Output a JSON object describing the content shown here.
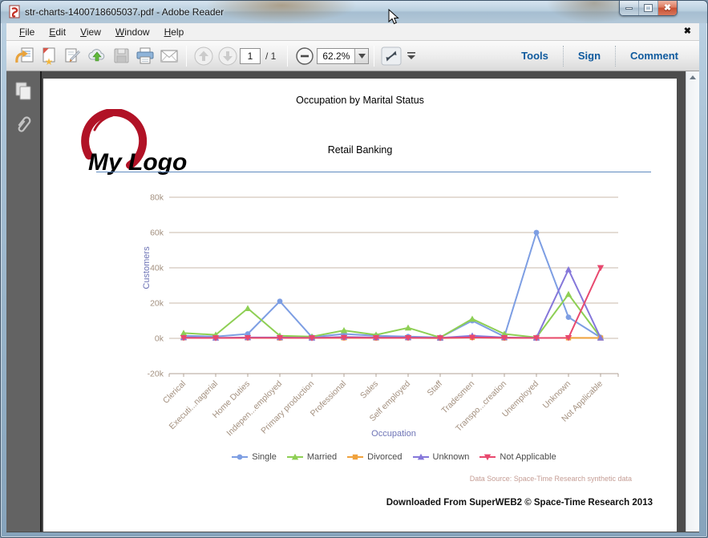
{
  "window": {
    "title": "str-charts-1400718605037.pdf - Adobe Reader"
  },
  "menubar": {
    "items": [
      {
        "label": "File"
      },
      {
        "label": "Edit"
      },
      {
        "label": "View"
      },
      {
        "label": "Window"
      },
      {
        "label": "Help"
      }
    ],
    "close_glyph": "✖"
  },
  "toolbar": {
    "icons": [
      "open-icon",
      "create-pdf-icon",
      "sign-doc-icon",
      "cloud-upload-icon",
      "save-icon",
      "print-icon",
      "email-icon",
      "prev-page-icon",
      "next-page-icon",
      "zoom-out-icon",
      "fit-window-icon",
      "toolbar-overflow-icon"
    ],
    "page_current": "1",
    "page_total": "/ 1",
    "zoom_value": "62.2%",
    "tools_label": "Tools",
    "sign_label": "Sign",
    "comment_label": "Comment"
  },
  "sidebar": {
    "icons": [
      "page-thumbnails-icon",
      "attachments-icon"
    ]
  },
  "document": {
    "title": "Occupation by Marital Status",
    "subtitle": "Retail Banking",
    "logo_text": "My Logo",
    "data_source": "Data Source: Space-Time Research synthetic data",
    "footer": "Downloaded From SuperWEB2 © Space-Time Research 2013"
  },
  "chart_data": {
    "type": "line",
    "title": "Occupation by Marital Status",
    "subtitle": "Retail Banking",
    "xlabel": "Occupation",
    "ylabel": "Customers",
    "ylim": [
      -20000,
      80000
    ],
    "ytick_labels": [
      "80k",
      "60k",
      "40k",
      "20k",
      "0k",
      "-20k"
    ],
    "ytick_values": [
      80000,
      60000,
      40000,
      20000,
      0,
      -20000
    ],
    "grid": "horizontal",
    "legend_position": "bottom",
    "axis_text_color": "#a3907f",
    "axis_title_color": "#6e74b6",
    "gridline_color": "#c9b9ab",
    "axisline_color": "#b1a295",
    "categories": [
      "Clerical",
      "Executi...nagerial",
      "Home Duties",
      "Indepen...employed",
      "Primary production",
      "Professional",
      "Sales",
      "Self employed",
      "Staff",
      "Tradesmen",
      "Transpo...creation",
      "Unemployed",
      "Unknown",
      "Not Applicable"
    ],
    "series": [
      {
        "name": "Single",
        "color": "#7d9ee3",
        "marker": "circle",
        "values": [
          1500,
          1000,
          2500,
          21000,
          700,
          2500,
          1500,
          1000,
          500,
          10000,
          1000,
          60000,
          12000,
          500
        ]
      },
      {
        "name": "Married",
        "color": "#8ecf54",
        "marker": "triangle",
        "values": [
          3000,
          2000,
          17000,
          1500,
          1000,
          4500,
          2000,
          6000,
          500,
          11000,
          2500,
          500,
          25000,
          500
        ]
      },
      {
        "name": "Divorced",
        "color": "#f0a23d",
        "marker": "square",
        "values": [
          300,
          200,
          300,
          200,
          200,
          300,
          200,
          300,
          100,
          500,
          200,
          200,
          300,
          200
        ]
      },
      {
        "name": "Unknown",
        "color": "#8577da",
        "marker": "triangle",
        "values": [
          500,
          300,
          500,
          500,
          300,
          800,
          500,
          500,
          300,
          1500,
          500,
          300,
          39000,
          300
        ]
      },
      {
        "name": "Not Applicable",
        "color": "#e8486e",
        "marker": "triangle-down",
        "values": [
          300,
          200,
          300,
          300,
          200,
          400,
          300,
          300,
          200,
          500,
          300,
          200,
          300,
          40000
        ]
      }
    ]
  }
}
